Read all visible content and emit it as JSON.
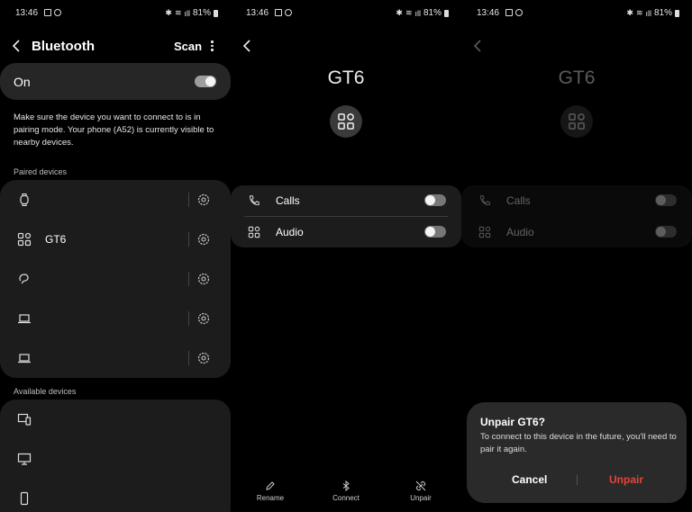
{
  "status_bar": {
    "time": "13:46",
    "battery": "81%"
  },
  "bluetooth_screen": {
    "title": "Bluetooth",
    "scan_label": "Scan",
    "toggle_label": "On",
    "toggle_state": "on",
    "description": "Make sure the device you want to connect to is in pairing mode. Your phone (A52) is currently visible to nearby devices.",
    "paired_header": "Paired devices",
    "paired_devices": [
      {
        "icon": "watch-icon",
        "name": ""
      },
      {
        "icon": "device-grid-icon",
        "name": "GT6"
      },
      {
        "icon": "earbuds-icon",
        "name": ""
      },
      {
        "icon": "laptop-icon",
        "name": ""
      },
      {
        "icon": "laptop-icon",
        "name": ""
      }
    ],
    "available_header": "Available devices",
    "available_devices": [
      {
        "icon": "multi-device-icon"
      },
      {
        "icon": "monitor-icon"
      },
      {
        "icon": "phone-icon"
      }
    ]
  },
  "device_screen": {
    "device_name": "GT6",
    "services": [
      {
        "icon": "phone-call-icon",
        "label": "Calls",
        "state": "off"
      },
      {
        "icon": "device-grid-icon",
        "label": "Audio",
        "state": "off"
      }
    ],
    "actions": [
      {
        "icon": "pencil-icon",
        "label": "Rename"
      },
      {
        "icon": "bluetooth-icon",
        "label": "Connect"
      },
      {
        "icon": "unlink-icon",
        "label": "Unpair"
      }
    ]
  },
  "unpair_dialog": {
    "title": "Unpair GT6?",
    "message": "To connect to this device in the future, you'll need to pair it again.",
    "cancel_label": "Cancel",
    "confirm_label": "Unpair",
    "confirm_color": "#e0463a"
  },
  "colors": {
    "background": "#000000",
    "card": "#1c1c1c",
    "on_card": "#262626",
    "dialog": "#2a2a2a"
  }
}
